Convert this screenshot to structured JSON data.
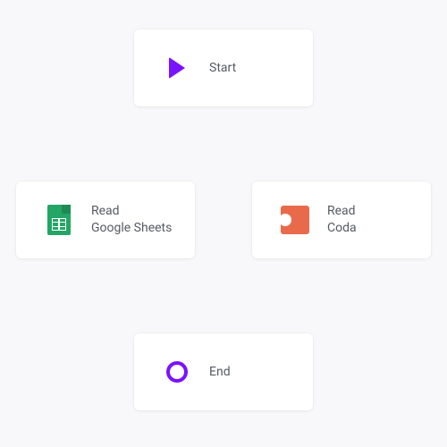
{
  "nodes": {
    "start": {
      "label": "Start",
      "icon": "play-icon",
      "color": "#7a12ff"
    },
    "sheets": {
      "label": "Read\nGoogle Sheets",
      "icon": "google-sheets-icon",
      "color": "#23a566"
    },
    "coda": {
      "label": "Read\nCoda",
      "icon": "coda-icon",
      "color": "#e96a4b"
    },
    "end": {
      "label": "End",
      "icon": "ring-icon",
      "color": "#7a12ff"
    }
  }
}
